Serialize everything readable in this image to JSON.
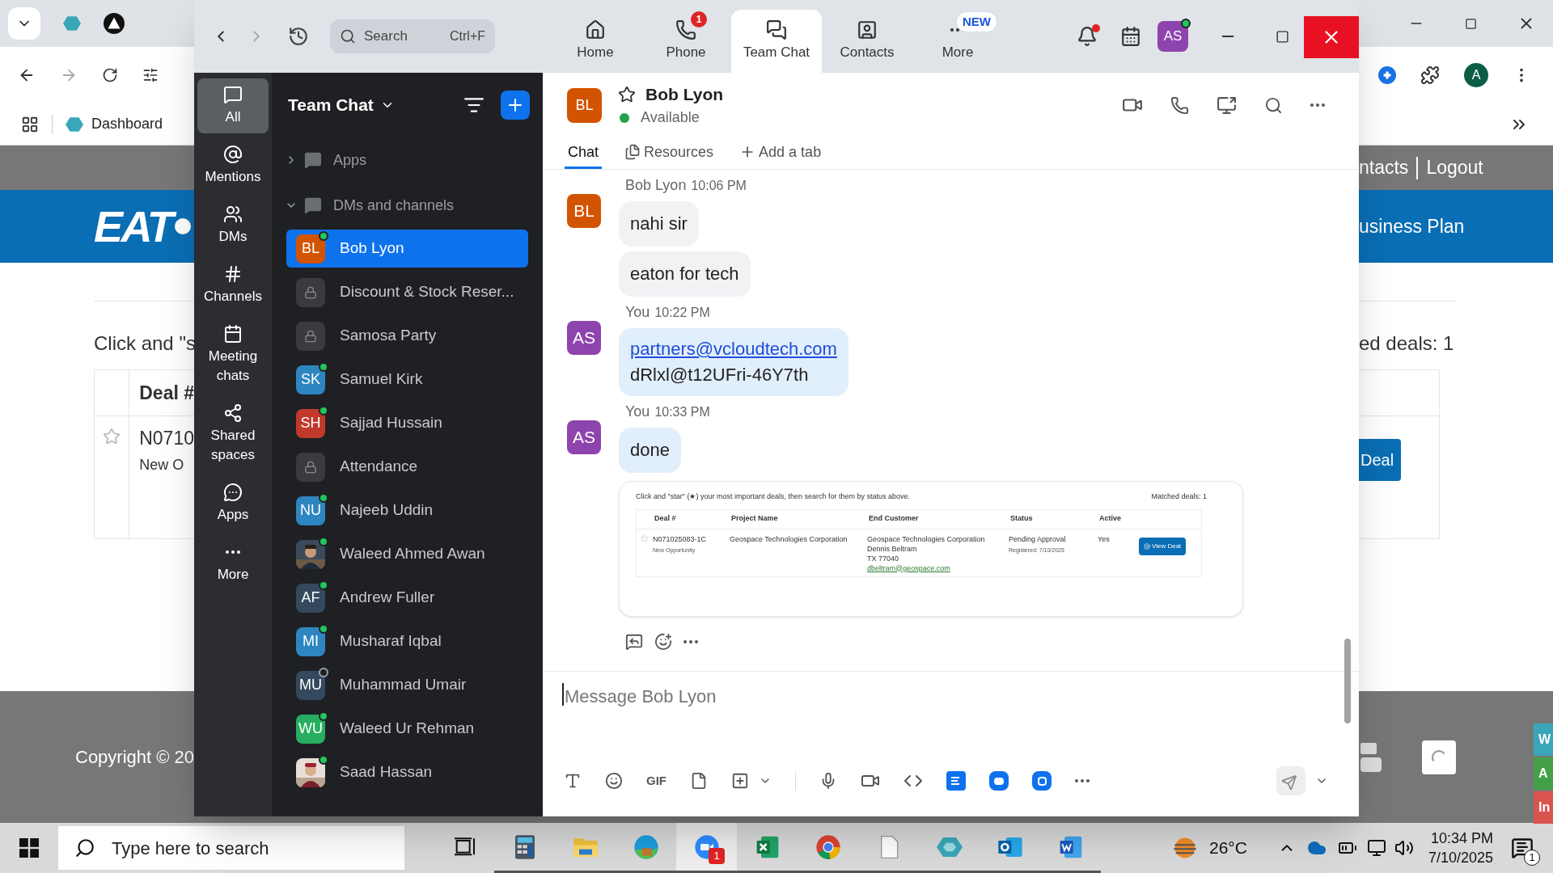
{
  "browser": {
    "bookmark": "Dashboard",
    "profile_initial": "A",
    "site": {
      "nav_right": [
        "ntacts",
        "Logout"
      ],
      "logo": "EAT",
      "banner_right": "usiness Plan",
      "intro": "Click and \"s",
      "matched": "ed deals: 1",
      "table_header": "Deal #",
      "deal": "N0710",
      "deal_sub": "New O",
      "button": "Deal",
      "footer": "Copyright © 20",
      "side_tabs": [
        {
          "label": "W",
          "color": "#3aa6b9"
        },
        {
          "label": "A",
          "color": "#43a047"
        },
        {
          "label": "In",
          "color": "#d9534f"
        }
      ]
    }
  },
  "zoom": {
    "search": {
      "placeholder": "Search",
      "shortcut": "Ctrl+F"
    },
    "nav_tabs": [
      {
        "kind": "home",
        "label": "Home",
        "selected": false
      },
      {
        "kind": "phone",
        "label": "Phone",
        "badge": "1",
        "selected": false
      },
      {
        "kind": "chat",
        "label": "Team Chat",
        "selected": true
      },
      {
        "kind": "contacts",
        "label": "Contacts",
        "selected": false
      },
      {
        "kind": "more",
        "label": "More",
        "tag": "NEW",
        "selected": false
      }
    ],
    "bell_unread": true,
    "user": {
      "initials": "AS",
      "color": "#8e44ad",
      "online": true
    },
    "rail": [
      {
        "kind": "chat",
        "label": "All",
        "selected": true
      },
      {
        "kind": "at",
        "label": "Mentions",
        "selected": false
      },
      {
        "kind": "users",
        "label": "DMs",
        "selected": false
      },
      {
        "kind": "hash",
        "label": "Channels",
        "selected": false
      },
      {
        "kind": "calendar",
        "label": "Meeting chats",
        "selected": false
      },
      {
        "kind": "share",
        "label": "Shared spaces",
        "selected": false
      },
      {
        "kind": "apps",
        "label": "Apps",
        "selected": false
      },
      {
        "kind": "more",
        "label": "More",
        "selected": false
      }
    ],
    "sidebar": {
      "title": "Team Chat",
      "sections": [
        {
          "label": "Apps",
          "expanded": false
        },
        {
          "label": "DMs and channels",
          "expanded": true
        }
      ],
      "items": [
        {
          "name": "Bob Lyon",
          "kind": "initials",
          "initials": "BL",
          "color": "#d35400",
          "online": true,
          "selected": true
        },
        {
          "name": "Discount & Stock Reser...",
          "kind": "lock",
          "selected": false
        },
        {
          "name": "Samosa Party",
          "kind": "lock",
          "selected": false
        },
        {
          "name": "Samuel Kirk",
          "kind": "initials",
          "initials": "SK",
          "color": "#2e86c1",
          "online": true,
          "selected": false
        },
        {
          "name": "Sajjad Hussain",
          "kind": "initials",
          "initials": "SH",
          "color": "#c0392b",
          "online": true,
          "selected": false
        },
        {
          "name": "Attendance",
          "kind": "lock",
          "selected": false
        },
        {
          "name": "Najeeb Uddin",
          "kind": "initials",
          "initials": "NU",
          "color": "#2e86c1",
          "online": true,
          "selected": false
        },
        {
          "name": "Waleed Ahmed Awan",
          "online": true,
          "selected": false
        },
        {
          "name": "Andrew Fuller",
          "kind": "initials",
          "initials": "AF",
          "color": "#34495e",
          "online": true,
          "selected": false
        },
        {
          "name": "Musharaf Iqbal",
          "kind": "initials",
          "initials": "MI",
          "color": "#2e86c1",
          "online": true,
          "selected": false
        },
        {
          "name": "Muhammad Umair",
          "kind": "initials",
          "initials": "MU",
          "color": "#34495e",
          "online": false,
          "selected": false
        },
        {
          "name": "Waleed Ur Rehman",
          "kind": "initials",
          "initials": "WU",
          "color": "#27ae60",
          "online": true,
          "selected": false
        },
        {
          "name": "Saad Hassan",
          "online": true,
          "selected": false
        }
      ]
    },
    "chat": {
      "contact": {
        "initials": "BL",
        "color": "#d35400",
        "name": "Bob Lyon",
        "status_text": "Available",
        "starred": false
      },
      "tabs": [
        {
          "kind": "chat",
          "label": "Chat",
          "selected": true
        },
        {
          "kind": "files",
          "label": "Resources",
          "selected": false
        },
        {
          "kind": "add",
          "label": "Add a tab",
          "selected": false
        }
      ],
      "messages": [
        {
          "sender": "Bob Lyon",
          "time": "10:06 PM",
          "initials": "BL",
          "color": "#d35400",
          "mine": false,
          "bubbles": [
            {
              "kind": "text",
              "text": "nahi sir"
            },
            {
              "kind": "text",
              "text": "eaton for tech"
            }
          ]
        },
        {
          "sender": "You",
          "time": "10:22 PM",
          "initials": "AS",
          "color": "#8e44ad",
          "mine": true,
          "bubbles": [
            {
              "kind": "credentials",
              "link": "partners@vcloudtech.com",
              "text": "dRlxl@t12UFri-46Y7th"
            }
          ]
        },
        {
          "sender": "You",
          "time": "10:33 PM",
          "initials": "AS",
          "color": "#8e44ad",
          "mine": true,
          "bubbles": [
            {
              "kind": "text",
              "text": "done"
            }
          ]
        }
      ],
      "attachment": {
        "intro": "Click and \"star\" (★) your most important deals, then search for them by status above.",
        "matched": "Matched deals: 1",
        "columns": [
          "Deal #",
          "Project Name",
          "End Customer",
          "Status",
          "Active"
        ],
        "row": {
          "deal": "N071025083-1C",
          "deal_sub": "New Opportunity",
          "project": "Geospace Technologies Corporation",
          "customer": [
            "Geospace Technologies Corporation",
            "Dennis Beltram",
            "TX 77040"
          ],
          "email": "dbeltram@geospace.com",
          "status": "Pending Approval",
          "registered": "Registered: 7/10/2025",
          "active": "Yes",
          "button": "View Deal"
        }
      },
      "composer": {
        "placeholder": "Message Bob Lyon",
        "gif": "GIF"
      }
    }
  },
  "taskbar": {
    "search_placeholder": "Type here to search",
    "apps": [
      {
        "kind": "taskview",
        "running": false,
        "active": false
      },
      {
        "kind": "calculator",
        "running": true,
        "active": false
      },
      {
        "kind": "explorer",
        "running": true,
        "active": false
      },
      {
        "kind": "edge",
        "running": true,
        "active": false
      },
      {
        "kind": "zoom",
        "running": true,
        "active": true,
        "badge": "1"
      },
      {
        "kind": "excel",
        "running": true,
        "active": false
      },
      {
        "kind": "chrome",
        "running": true,
        "active": false
      },
      {
        "kind": "file",
        "running": true,
        "active": false
      },
      {
        "kind": "diamond",
        "running": true,
        "active": false
      },
      {
        "kind": "outlook",
        "running": true,
        "active": false
      },
      {
        "kind": "word",
        "running": true,
        "active": false
      }
    ],
    "weather": "26°C",
    "time": "10:34 PM",
    "date": "7/10/2025",
    "notifications": "1"
  }
}
